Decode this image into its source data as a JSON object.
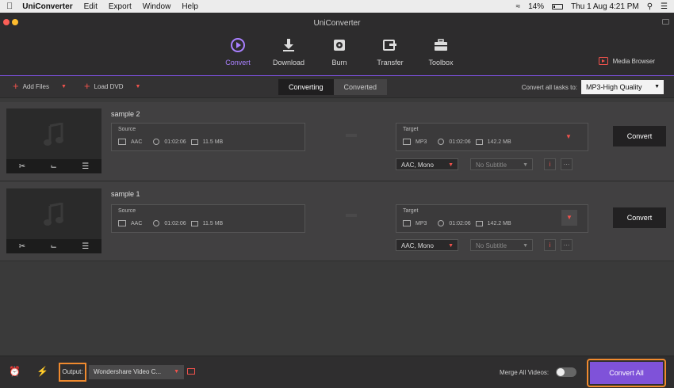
{
  "menubar": {
    "app_name": "UniConverter",
    "menus": [
      "Edit",
      "Export",
      "Window",
      "Help"
    ],
    "battery": "14%",
    "datetime": "Thu 1 Aug  4:21 PM"
  },
  "window": {
    "title": "UniConverter"
  },
  "nav": {
    "items": [
      {
        "label": "Convert",
        "icon": "play-circle-icon"
      },
      {
        "label": "Download",
        "icon": "download-icon"
      },
      {
        "label": "Burn",
        "icon": "disc-icon"
      },
      {
        "label": "Transfer",
        "icon": "transfer-icon"
      },
      {
        "label": "Toolbox",
        "icon": "toolbox-icon"
      }
    ],
    "active": "Convert",
    "media_browser": "Media Browser"
  },
  "toolbar": {
    "add_files": "Add Files",
    "load_dvd": "Load DVD",
    "tab_converting": "Converting",
    "tab_converted": "Converted",
    "convert_all_tasks_label": "Convert all tasks to:",
    "preset": "MP3-High Quality"
  },
  "files": [
    {
      "name": "sample 2",
      "source": {
        "label": "Source",
        "format": "AAC",
        "duration": "01:02:06",
        "size": "11.5 MB"
      },
      "target": {
        "label": "Target",
        "format": "MP3",
        "duration": "01:02:06",
        "size": "142.2 MB"
      },
      "audio": "AAC, Mono",
      "subtitle": "No Subtitle",
      "convert_label": "Convert"
    },
    {
      "name": "sample 1",
      "source": {
        "label": "Source",
        "format": "AAC",
        "duration": "01:02:06",
        "size": "11.5 MB"
      },
      "target": {
        "label": "Target",
        "format": "MP3",
        "duration": "01:02:06",
        "size": "142.2 MB"
      },
      "audio": "AAC, Mono",
      "subtitle": "No Subtitle",
      "convert_label": "Convert"
    }
  ],
  "bottom": {
    "output_label": "Output:",
    "output_path": "Wondershare Video C...",
    "merge_label": "Merge All Videos:",
    "convert_all": "Convert All"
  },
  "colors": {
    "accent": "#7f52d9",
    "highlight": "#f08a2e",
    "red": "#f0524c"
  }
}
